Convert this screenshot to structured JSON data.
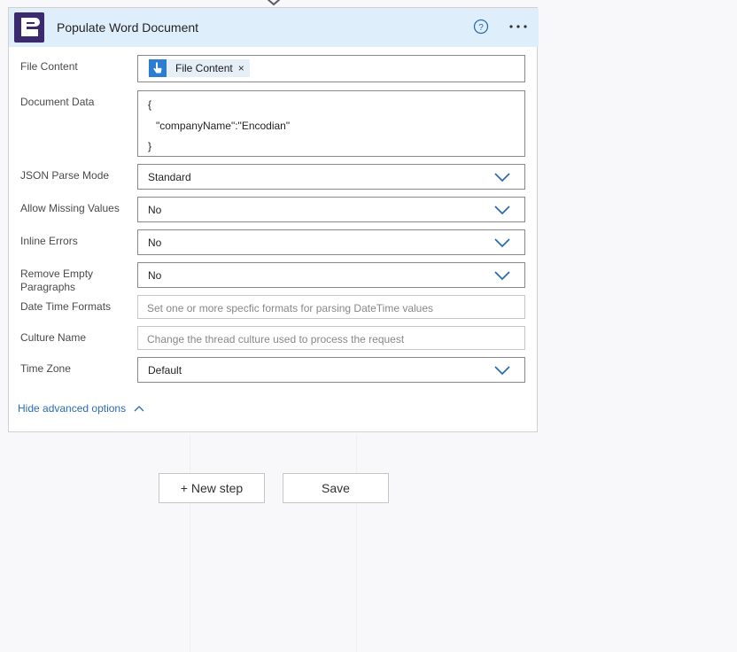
{
  "card": {
    "title": "Populate Word Document",
    "help_icon": "help-circle-icon",
    "more_icon": "more-options-icon",
    "app_icon": "encodian-logo-icon"
  },
  "fields": {
    "file_content": {
      "label": "File Content",
      "token": "File Content",
      "token_remove": "×"
    },
    "document_data": {
      "label": "Document Data",
      "lines": [
        "{",
        "\"companyName\":\"Encodian\"",
        "}"
      ]
    },
    "json_parse_mode": {
      "label": "JSON Parse Mode",
      "value": "Standard"
    },
    "allow_missing_values": {
      "label": "Allow Missing Values",
      "value": "No"
    },
    "inline_errors": {
      "label": "Inline Errors",
      "value": "No"
    },
    "remove_empty_paragraphs": {
      "label_line1": "Remove Empty",
      "label_line2": "Paragraphs",
      "value": "No"
    },
    "date_time_formats": {
      "label": "Date Time Formats",
      "placeholder": "Set one or more specfic formats for parsing DateTime values"
    },
    "culture_name": {
      "label": "Culture Name",
      "placeholder": "Change the thread culture used to process the request"
    },
    "time_zone": {
      "label": "Time Zone",
      "value": "Default"
    }
  },
  "advanced_toggle": "Hide advanced options",
  "buttons": {
    "new_step": "+ New step",
    "save": "Save"
  },
  "colors": {
    "header_bg": "#dfeefb",
    "accent": "#2b7cd3",
    "link": "#2b6cb5",
    "app_icon_bg": "#3b2a6e"
  }
}
